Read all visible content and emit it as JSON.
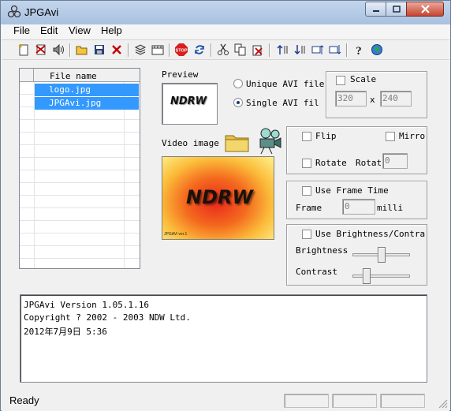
{
  "window": {
    "title": "JPGAvi"
  },
  "menu": [
    "File",
    "Edit",
    "View",
    "Help"
  ],
  "toolbar": {
    "icons": [
      "new-icon",
      "remove-icon",
      "sound-icon",
      "open-icon",
      "save-icon",
      "delete-icon",
      "stack-icon",
      "film-icon",
      "stop-icon",
      "refresh-icon",
      "cut-icon",
      "copy-icon",
      "paste-icon",
      "sort-asc-icon",
      "sort-desc-icon",
      "move-up-icon",
      "move-down-icon",
      "help-icon",
      "web-icon"
    ]
  },
  "file_list": {
    "header": "File name",
    "files": [
      "logo.jpg",
      "JPGAvi.jpg"
    ]
  },
  "preview": {
    "label": "Preview",
    "text": "NDRW"
  },
  "avi_mode": {
    "unique_label": "Unique AVI file",
    "single_label": "Single AVI fil",
    "selected": "single"
  },
  "scale": {
    "label": "Scale",
    "width": "320",
    "height": "240",
    "x_label": "x"
  },
  "video_image": {
    "label": "Video image",
    "text": "NDRW",
    "caption": "JPGAVi ver.1"
  },
  "flip": {
    "flip_label": "Flip",
    "mirror_label": "Mirro",
    "rotate_label": "Rotate",
    "rotate_field_label": "Rotat",
    "rotate_value": "0"
  },
  "frame_time": {
    "label": "Use Frame Time",
    "frame_label": "Frame",
    "value": "0",
    "unit": "milli"
  },
  "brightness": {
    "label": "Use Brightness/Contra",
    "brightness_label": "Brightness",
    "contrast_label": "Contrast",
    "brightness_level": 0.5,
    "contrast_level": 0.2
  },
  "log": {
    "lines": [
      "JPGAvi Version   1.05.1.16",
      "Copyright ? 2002 - 2003 NDW Ltd.",
      "2012年7月9日 5:36"
    ]
  },
  "status": {
    "text": "Ready"
  },
  "colors": {
    "selection": "#3399ff",
    "title_bar": "#b4c9e4",
    "close_button": "#c7442f"
  }
}
